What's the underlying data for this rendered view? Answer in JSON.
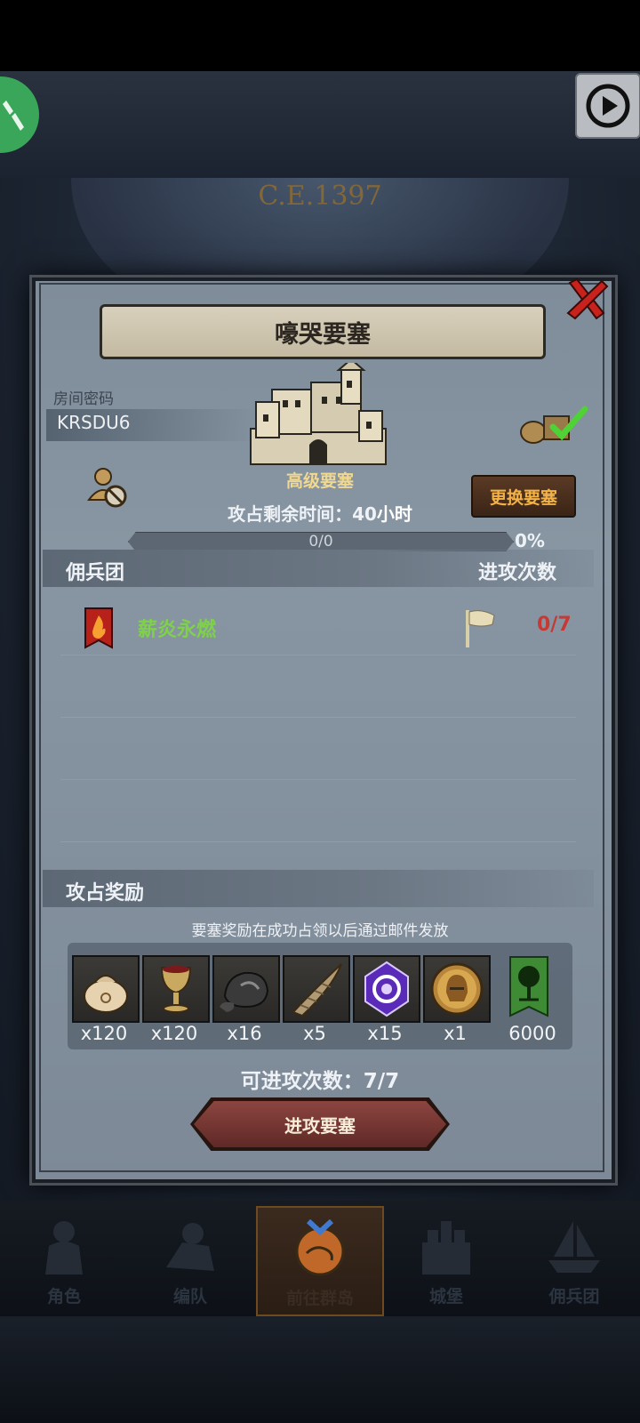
{
  "top": {
    "tool_icon": "wrench-icon",
    "play_icon": "play-circle-icon"
  },
  "scene": {
    "era_text": "C.E.1397"
  },
  "dialog": {
    "title": "嚎哭要塞",
    "room_code_label": "房间密码",
    "room_code": "KRSDU6",
    "fortress_grade": "高级要塞",
    "change_button": "更换要塞",
    "remaining_prefix": "攻占剩余时间：40",
    "remaining_unit": "小时",
    "progress_text": "0/0",
    "progress_value": 0,
    "progress_percent": "0%",
    "guild_header": "佣兵团",
    "attacks_header": "进攻次数",
    "guild_rows": [
      {
        "name": "薪炎永燃",
        "attacks": "0/7"
      }
    ],
    "rewards_header": "攻占奖励",
    "rewards_note": "要塞奖励在成功占领以后通过邮件发放",
    "rewards": [
      {
        "icon": "money-bag-icon",
        "qty": "x120"
      },
      {
        "icon": "goblet-icon",
        "qty": "x120"
      },
      {
        "icon": "ore-icon",
        "qty": "x16"
      },
      {
        "icon": "horn-icon",
        "qty": "x5"
      },
      {
        "icon": "purple-crystal-icon",
        "qty": "x15"
      },
      {
        "icon": "helmet-medal-icon",
        "qty": "x1"
      },
      {
        "icon": "tree-banner-icon",
        "qty": "6000"
      }
    ],
    "available_attacks": "可进攻次数：7/7",
    "attack_button": "进攻要塞",
    "colors": {
      "guild_name": "#7fd14a",
      "attack_count": "#c53a34",
      "change_button_text": "#f2b248"
    }
  },
  "nav": {
    "items": [
      {
        "label": "角色",
        "icon": "knight-icon"
      },
      {
        "label": "编队",
        "icon": "formation-icon"
      },
      {
        "label": "前往群岛",
        "icon": "island-map-icon",
        "active": true
      },
      {
        "label": "城堡",
        "icon": "castle-icon"
      },
      {
        "label": "佣兵团",
        "icon": "mercenary-ship-icon"
      }
    ]
  }
}
